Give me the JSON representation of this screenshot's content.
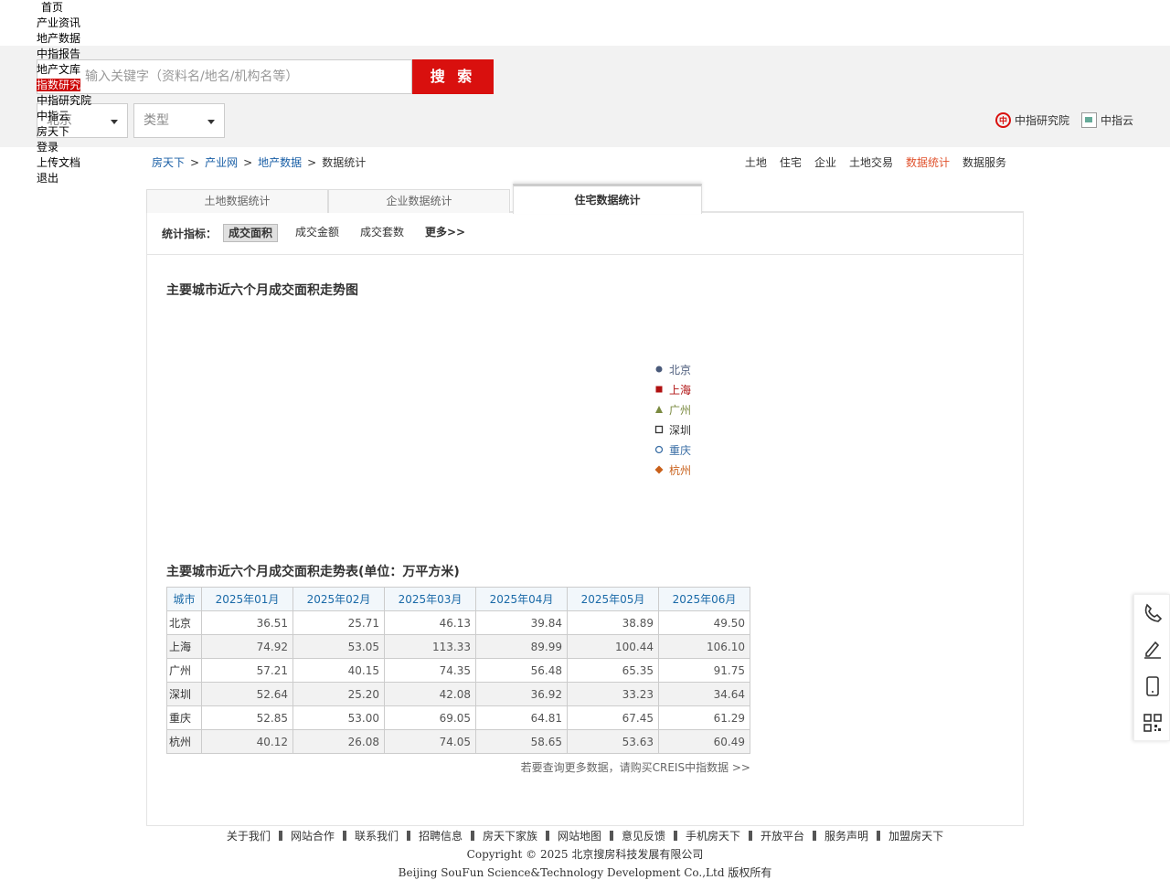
{
  "left_nav": [
    "首页",
    "产业资讯",
    "地产数据",
    "中指报告",
    "地产文库",
    "指数研究",
    "中指研究院",
    "中指云",
    "房天下",
    "登录",
    "上传文档",
    "退出"
  ],
  "left_nav_active": "指数研究",
  "search": {
    "placeholder": "输入关键字（资料名/地名/机构名等）",
    "button": "搜 索",
    "city_select": "北京",
    "type_select": "类型"
  },
  "brand_links": {
    "research": "中指研究院",
    "cloud": "中指云"
  },
  "breadcrumb": [
    "房天下",
    "产业网",
    "地产数据",
    "数据统计"
  ],
  "top_nav": [
    "土地",
    "住宅",
    "企业",
    "土地交易",
    "数据统计",
    "数据服务"
  ],
  "top_nav_active": "数据统计",
  "tabs": [
    "土地数据统计",
    "企业数据统计",
    "住宅数据统计"
  ],
  "tab_active": "住宅数据统计",
  "indicators": {
    "label": "统计指标：",
    "items": [
      "成交面积",
      "成交金额",
      "成交套数",
      "更多>>"
    ],
    "active": "成交面积"
  },
  "chart_title": "主要城市近六个月成交面积走势图",
  "chart_data": {
    "type": "line",
    "title": "主要城市近六个月成交面积走势图",
    "legend": "right",
    "series": [
      {
        "name": "北京",
        "color": "#4a5a7a",
        "marker": "circle"
      },
      {
        "name": "上海",
        "color": "#b01010",
        "marker": "square"
      },
      {
        "name": "广州",
        "color": "#7a8a40",
        "marker": "triangle"
      },
      {
        "name": "深圳",
        "color": "#333333",
        "marker": "square-open"
      },
      {
        "name": "重庆",
        "color": "#3a6ea5",
        "marker": "circle-open"
      },
      {
        "name": "杭州",
        "color": "#c9601a",
        "marker": "diamond"
      }
    ]
  },
  "table_title": "主要城市近六个月成交面积走势表(单位：万平方米)",
  "table": {
    "headers": [
      "城市",
      "2025年01月",
      "2025年02月",
      "2025年03月",
      "2025年04月",
      "2025年05月",
      "2025年06月"
    ],
    "rows": [
      [
        "北京",
        "36.51",
        "25.71",
        "46.13",
        "39.84",
        "38.89",
        "49.50"
      ],
      [
        "上海",
        "74.92",
        "53.05",
        "113.33",
        "89.99",
        "100.44",
        "106.10"
      ],
      [
        "广州",
        "57.21",
        "40.15",
        "74.35",
        "56.48",
        "65.35",
        "91.75"
      ],
      [
        "深圳",
        "52.64",
        "25.20",
        "42.08",
        "36.92",
        "33.23",
        "34.64"
      ],
      [
        "重庆",
        "52.85",
        "53.00",
        "69.05",
        "64.81",
        "67.45",
        "61.29"
      ],
      [
        "杭州",
        "40.12",
        "26.08",
        "74.05",
        "58.65",
        "53.63",
        "60.49"
      ]
    ]
  },
  "more_link": "若要查询更多数据，请购买CREIS中指数据 >>",
  "footer": {
    "links": [
      "关于我们",
      "网站合作",
      "联系我们",
      "招聘信息",
      "房天下家族",
      "网站地图",
      "意见反馈",
      "手机房天下",
      "开放平台",
      "服务声明",
      "加盟房天下"
    ],
    "copyright": "Copyright © 2025 北京搜房科技发展有限公司",
    "company_en": "Beijing SouFun Science&Technology Development Co.,Ltd 版权所有"
  },
  "side_tools": [
    "phone-icon",
    "edit-icon",
    "mobile-icon",
    "qrcode-icon"
  ],
  "colors": {
    "accent": "#d9100e",
    "link": "#1a5fa6",
    "active_nav": "#e0522d"
  }
}
